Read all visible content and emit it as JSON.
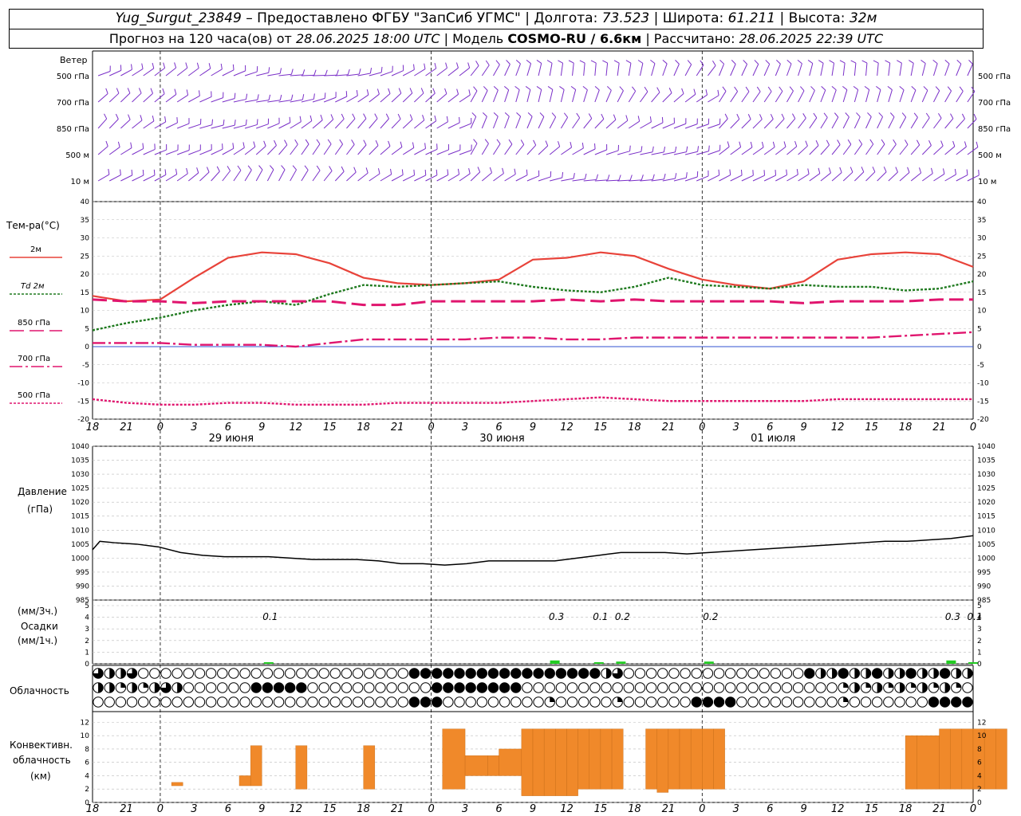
{
  "header": {
    "station": "Yug_Surgut_23849",
    "provider": "Предоставлено ФГБУ \"ЗапСиб УГМС\"",
    "lon_label": "Долгота:",
    "lon": "73.523",
    "lat_label": "Широта:",
    "lat": "61.211",
    "alt_label": "Высота:",
    "alt": "32м",
    "forecast_prefix": "Прогноз на 120 часа(ов) от",
    "forecast_start": "28.06.2025 18:00 UTC",
    "model_label": "Модель",
    "model": "COSMO-RU / 6.6км",
    "calc_label": "Рассчитано:",
    "calc_time": "28.06.2025 22:39 UTC"
  },
  "panels": {
    "wind": {
      "label": "Ветер",
      "levels": [
        "500 гПа",
        "700 гПа",
        "850 гПа",
        "500 м",
        "10 м"
      ]
    },
    "temp": {
      "label": "Тем-ра(°C)",
      "legend": [
        "2м",
        "Td 2м",
        "850 гПа",
        "700 гПа",
        "500 гПа"
      ]
    },
    "pressure": {
      "label_1": "Давление",
      "label_2": "(гПа)"
    },
    "precip": {
      "label_1": "(мм/3ч.)",
      "label_2": "Осадки",
      "label_3": "(мм/1ч.)"
    },
    "cloud": {
      "label": "Облачность"
    },
    "conv": {
      "label_1": "Конвективн.",
      "label_2": "облачность",
      "label_3": "(км)"
    }
  },
  "time_axis": {
    "ticks": [
      "18",
      "21",
      "0",
      "3",
      "6",
      "9",
      "12",
      "15",
      "18",
      "21",
      "0",
      "3",
      "6",
      "9",
      "12",
      "15",
      "18",
      "21",
      "0",
      "3",
      "6",
      "9",
      "12",
      "15",
      "18",
      "21",
      "0"
    ],
    "dates": [
      "29 июня",
      "30 июня",
      "01 июля"
    ]
  },
  "colors": {
    "t2m": "#e8433a",
    "td": "#1f7a1f",
    "t850": "#e0156e",
    "t700": "#e0156e",
    "t500": "#e0156e",
    "wind": "#7a2fc8",
    "precip": "#22cc22",
    "conv": "#f0892a",
    "zero": "#3050d0"
  },
  "chart_data": [
    {
      "type": "line",
      "title": "Тем-ра(°C)",
      "x": [
        0,
        3,
        6,
        9,
        12,
        15,
        18,
        21,
        24,
        27,
        30,
        33,
        36,
        39,
        42,
        45,
        48,
        51,
        54,
        57,
        60,
        63,
        66,
        69,
        72,
        75,
        78
      ],
      "ylim": [
        -20,
        40
      ],
      "series": [
        {
          "name": "2м",
          "values": [
            14,
            12.5,
            13,
            19,
            24.5,
            26,
            25.5,
            23,
            19,
            17.5,
            17,
            17.5,
            18.5,
            24,
            24.5,
            26,
            25,
            21.5,
            18.5,
            17,
            16,
            18,
            24,
            25.5,
            26,
            25.5,
            22
          ]
        },
        {
          "name": "Td 2м",
          "values": [
            4.5,
            6.5,
            8,
            10,
            11.5,
            12.5,
            11.5,
            14.5,
            17,
            16.5,
            17,
            17.5,
            18,
            16.5,
            15.5,
            15,
            16.5,
            19,
            17,
            16.5,
            16,
            17,
            16.5,
            16.5,
            15.5,
            16,
            18
          ]
        },
        {
          "name": "850 гПа",
          "values": [
            13,
            12.5,
            12.5,
            12,
            12.5,
            12.5,
            12.5,
            12.5,
            11.5,
            11.5,
            12.5,
            12.5,
            12.5,
            12.5,
            13,
            12.5,
            13,
            12.5,
            12.5,
            12.5,
            12.5,
            12,
            12.5,
            12.5,
            12.5,
            13,
            13
          ]
        },
        {
          "name": "700 гПа",
          "values": [
            1,
            1,
            1,
            0.5,
            0.5,
            0.5,
            0,
            1,
            2,
            2,
            2,
            2,
            2.5,
            2.5,
            2,
            2,
            2.5,
            2.5,
            2.5,
            2.5,
            2.5,
            2.5,
            2.5,
            2.5,
            3,
            3.5,
            4
          ]
        },
        {
          "name": "500 гПа",
          "values": [
            -14.5,
            -15.5,
            -16,
            -16,
            -15.5,
            -15.5,
            -16,
            -16,
            -16,
            -15.5,
            -15.5,
            -15.5,
            -15.5,
            -15,
            -14.5,
            -14,
            -14.5,
            -15,
            -15,
            -15,
            -15,
            -15,
            -14.5,
            -14.5,
            -14.5,
            -14.5,
            -14.5
          ]
        }
      ]
    },
    {
      "type": "line",
      "title": "Давление (гПа)",
      "x": [
        0,
        1,
        3,
        6,
        9,
        12,
        15,
        18,
        21,
        24,
        27,
        30,
        33,
        36,
        39,
        42,
        45,
        48,
        51,
        54,
        57,
        60,
        63,
        66,
        69,
        72,
        75,
        78,
        81,
        84,
        87,
        90,
        93,
        96,
        99,
        102,
        105,
        108,
        111,
        114,
        117,
        120
      ],
      "ylim": [
        985,
        1040
      ],
      "series": [
        {
          "name": "",
          "values": [
            1003,
            1006,
            1005.5,
            1005,
            1004,
            1002,
            1001,
            1000.5,
            1000.5,
            1000.5,
            1000,
            999.5,
            999.5,
            999.5,
            999,
            998,
            998,
            997.5,
            998,
            999,
            999,
            999,
            999,
            1000,
            1001,
            1002,
            1002,
            1002,
            1001.5,
            1002,
            1002.5,
            1003,
            1003.5,
            1004,
            1004.5,
            1005,
            1005.5,
            1006,
            1006,
            1006.5,
            1007,
            1008
          ]
        }
      ]
    },
    {
      "type": "bar",
      "title": "Осадки (мм/3ч.)",
      "x": [
        24,
        63,
        69,
        72,
        84,
        117,
        120
      ],
      "values": [
        0.1,
        0.3,
        0.1,
        0.2,
        0.2,
        0.3,
        0.1
      ],
      "labels": [
        "0.1",
        "0.3",
        "0.1",
        "0.2",
        "0.2",
        "0.3",
        "0.1"
      ],
      "ylim": [
        0,
        5
      ]
    },
    {
      "type": "bar",
      "title": "Конвективн. облачность (км)",
      "x_start": [
        7,
        13,
        14,
        18,
        24,
        31,
        33,
        35,
        36,
        38,
        39,
        40,
        41,
        42,
        43,
        44,
        45,
        46,
        49,
        50,
        51,
        52,
        53,
        54,
        55,
        72,
        73,
        75,
        76,
        77,
        78,
        79,
        80
      ],
      "x_end": [
        8,
        14,
        15,
        19,
        25,
        33,
        35,
        36,
        38,
        39,
        40,
        41,
        42,
        43,
        44,
        45,
        46,
        47,
        50,
        51,
        52,
        53,
        54,
        55,
        56,
        73,
        75,
        76,
        77,
        78,
        79,
        80,
        81
      ],
      "bottom": [
        2.5,
        2.5,
        2.5,
        2,
        2,
        2,
        4,
        4,
        4,
        1,
        1,
        1,
        1,
        1,
        2,
        2,
        2,
        2,
        2,
        1.5,
        2,
        2,
        2,
        2,
        2,
        2,
        2,
        2,
        2,
        2,
        2,
        2,
        2
      ],
      "top": [
        3,
        4,
        8.5,
        8.5,
        8.5,
        11,
        7,
        7,
        8,
        11,
        11,
        11,
        11,
        11,
        11,
        11,
        11,
        11,
        11,
        11,
        11,
        11,
        11,
        11,
        11,
        10,
        10,
        11,
        11,
        11,
        11,
        11,
        11
      ],
      "ylim": [
        0,
        13
      ]
    }
  ]
}
